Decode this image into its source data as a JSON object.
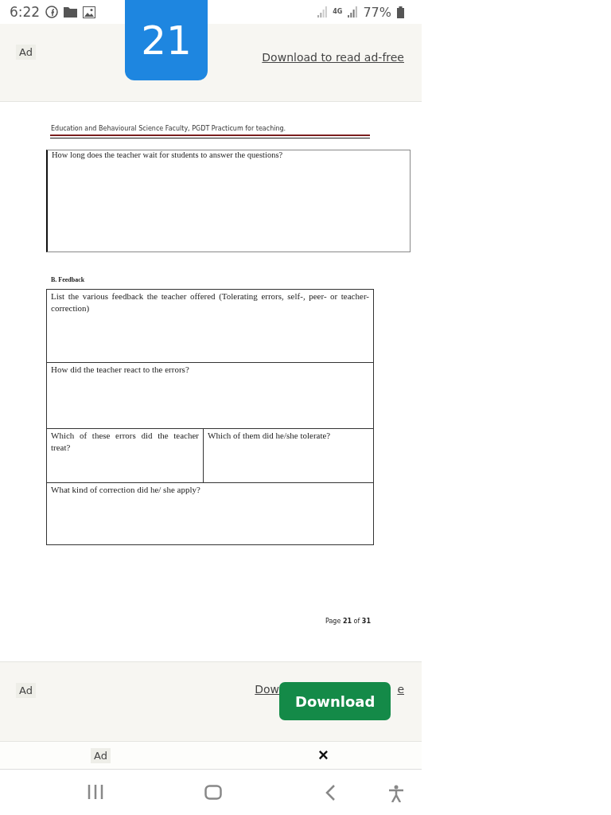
{
  "status_bar": {
    "time": "6:22",
    "network": "4G",
    "battery": "77%"
  },
  "page_badge": "21",
  "top_ad": {
    "label": "Ad",
    "link": "Download to read ad-free"
  },
  "document": {
    "header": "Education and Behavioural Science Faculty, PGDT Practicum for teaching.",
    "question_box": "How long does the teacher wait for students to answer the questions?",
    "section_title": "B. Feedback",
    "table": {
      "rows": [
        {
          "cells": [
            {
              "text": "List the various feedback the teacher offered (Tolerating errors, self-, peer- or teacher-correction)",
              "colspan": 2
            }
          ]
        },
        {
          "cells": [
            {
              "text": "How did the teacher react to the errors?",
              "colspan": 2
            }
          ]
        },
        {
          "cells": [
            {
              "text": "Which of these errors did the teacher treat?"
            },
            {
              "text": "Which of them did he/she tolerate?"
            }
          ]
        },
        {
          "cells": [
            {
              "text": "What kind of correction did he/ she apply?",
              "colspan": 2
            }
          ]
        }
      ]
    },
    "page_number": "Page **21** of **31**"
  },
  "bottom_ad": {
    "label": "Ad",
    "link_start": "Dow",
    "link_end": "e",
    "button": "Download"
  },
  "banner_ad": {
    "label": "Ad",
    "close": "×"
  }
}
